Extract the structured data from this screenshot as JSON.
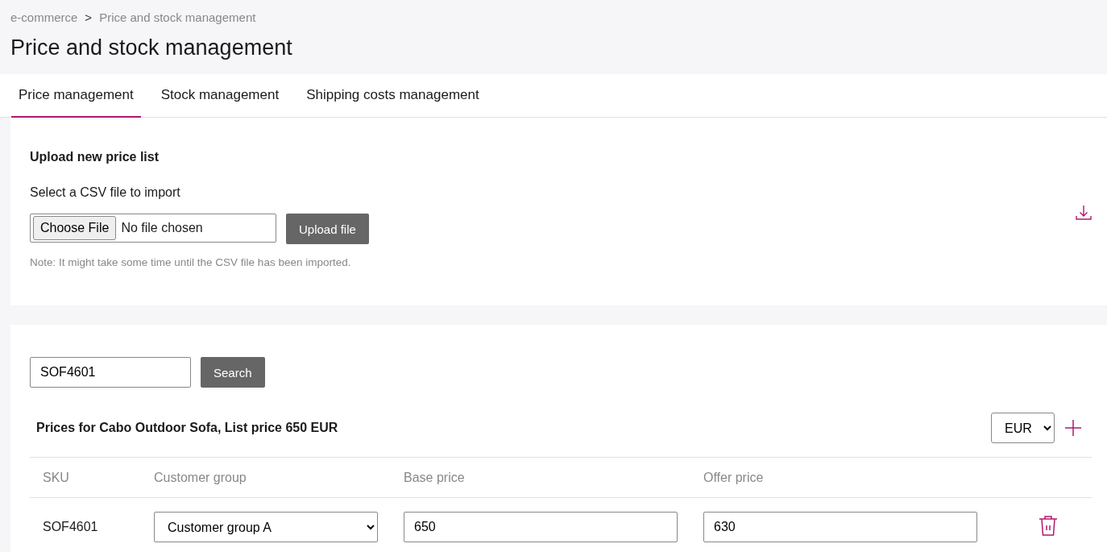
{
  "breadcrumb": [
    {
      "label": "e-commerce"
    },
    {
      "label": "Price and stock management"
    }
  ],
  "breadcrumb_separator": ">",
  "page_title": "Price and stock management",
  "tabs": [
    {
      "label": "Price management",
      "selected": true
    },
    {
      "label": "Stock management",
      "selected": false
    },
    {
      "label": "Shipping costs management",
      "selected": false
    }
  ],
  "upload": {
    "title": "Upload new price list",
    "label": "Select a CSV file to import",
    "choose_button": "Choose File",
    "file_status": "No file chosen",
    "upload_button": "Upload file",
    "note": "Note: It might take some time until the CSV file has been imported."
  },
  "search": {
    "value": "SOF4601",
    "button": "Search"
  },
  "prices": {
    "title": "Prices for Cabo Outdoor Sofa, List price 650 EUR",
    "currency": "EUR",
    "columns": [
      "SKU",
      "Customer group",
      "Base price",
      "Offer price"
    ],
    "rows": [
      {
        "sku": "SOF4601",
        "customer_group": "Customer group A",
        "base_price": "650",
        "offer_price": "630"
      }
    ]
  }
}
